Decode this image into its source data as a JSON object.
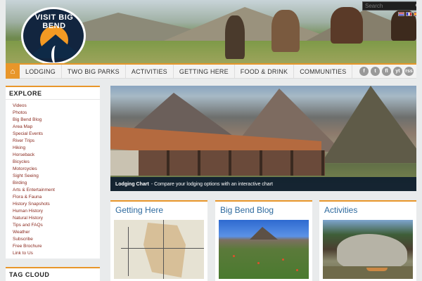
{
  "header": {
    "logo_text": "VISIT BIG BEND",
    "search_placeholder": "Search"
  },
  "nav": {
    "home_icon": "home-icon",
    "items": [
      "LODGING",
      "TWO BIG PARKS",
      "ACTIVITIES",
      "GETTING HERE",
      "FOOD & DRINK",
      "COMMUNITIES"
    ],
    "social": [
      "f",
      "t",
      "fl",
      "yt",
      "rss"
    ]
  },
  "sidebar": {
    "title": "EXPLORE",
    "links": [
      "Videos",
      "Photos",
      "Big Bend Blog",
      "Area Map",
      "Special Events",
      "River Trips",
      "Hiking",
      "Horseback",
      "Bicycles",
      "Motorcycles",
      "Sight Seeing",
      "Birding",
      "Arts & Entertainment",
      "Flora & Fauna",
      "History Snapshots",
      "Human History",
      "Natural History",
      "Tips and FAQs",
      "Weather",
      "Subscribe",
      "Free Brochure",
      "Link to Us"
    ]
  },
  "tagcloud": {
    "title": "TAG CLOUD"
  },
  "feature": {
    "caption_bold": "Lodging Chart",
    "caption_text": "- Compare your lodging options with an interactive chart"
  },
  "cards": [
    {
      "title": "Getting Here"
    },
    {
      "title": "Big Bend Blog"
    },
    {
      "title": "Activities"
    }
  ],
  "colors": {
    "accent": "#e8962a",
    "link": "#8a2a1f",
    "card_title": "#2e6a9e"
  }
}
